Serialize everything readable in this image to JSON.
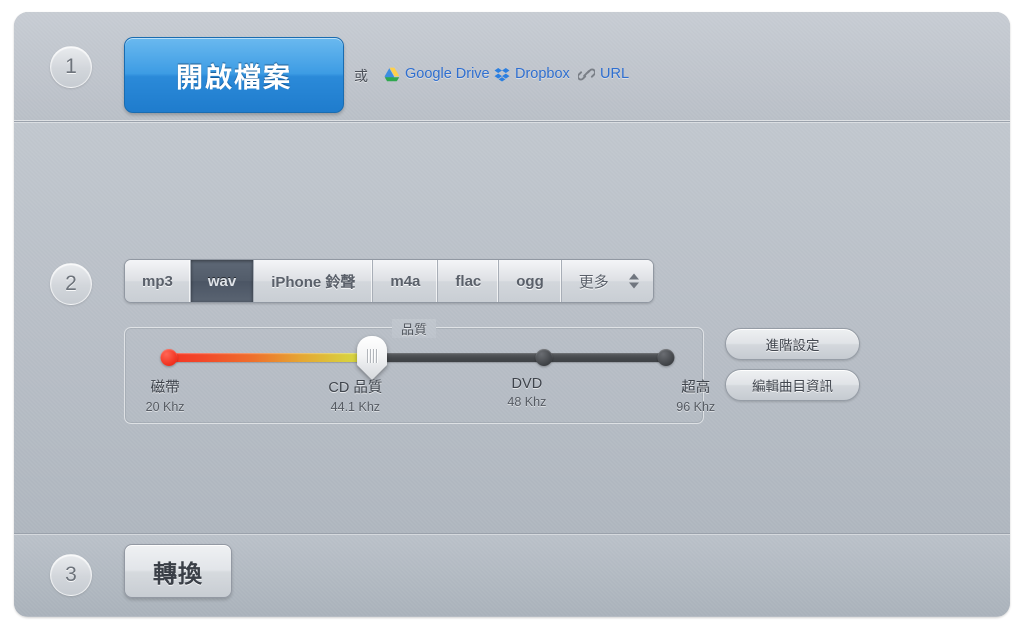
{
  "steps": {
    "one": "1",
    "two": "2",
    "three": "3"
  },
  "step1": {
    "open_file_label": "開啟檔案",
    "or_label": "或",
    "services": [
      {
        "label": "Google Drive",
        "icon": "google-drive-icon"
      },
      {
        "label": "Dropbox",
        "icon": "dropbox-icon"
      },
      {
        "label": "URL",
        "icon": "link-icon"
      }
    ]
  },
  "step2": {
    "formats": [
      {
        "label": "mp3",
        "selected": false
      },
      {
        "label": "wav",
        "selected": true
      },
      {
        "label": "iPhone 鈴聲",
        "selected": false
      },
      {
        "label": "m4a",
        "selected": false
      },
      {
        "label": "flac",
        "selected": false
      },
      {
        "label": "ogg",
        "selected": false
      }
    ],
    "more_label": "更多",
    "quality": {
      "legend": "品質",
      "marks": [
        {
          "name": "磁帶",
          "rate": "20 Khz",
          "position": 0
        },
        {
          "name": "CD 品質",
          "rate": "44.1 Khz",
          "position": 41
        },
        {
          "name": "DVD",
          "rate": "48 Khz",
          "position": 75
        },
        {
          "name": "超高",
          "rate": "96 Khz",
          "position": 108
        }
      ],
      "selected_index": 1
    },
    "advanced_label": "進階設定",
    "edit_track_label": "編輯曲目資訊"
  },
  "step3": {
    "convert_label": "轉換"
  },
  "colors": {
    "accent_blue": "#2b8ad9",
    "link_blue": "#2f6fd0",
    "selected_tab": "#525c6a",
    "slider_hot_start": "#f43222",
    "slider_hot_end": "#d2d845",
    "slider_cold": "#45484c",
    "panel_bg": "#b8bec6"
  }
}
